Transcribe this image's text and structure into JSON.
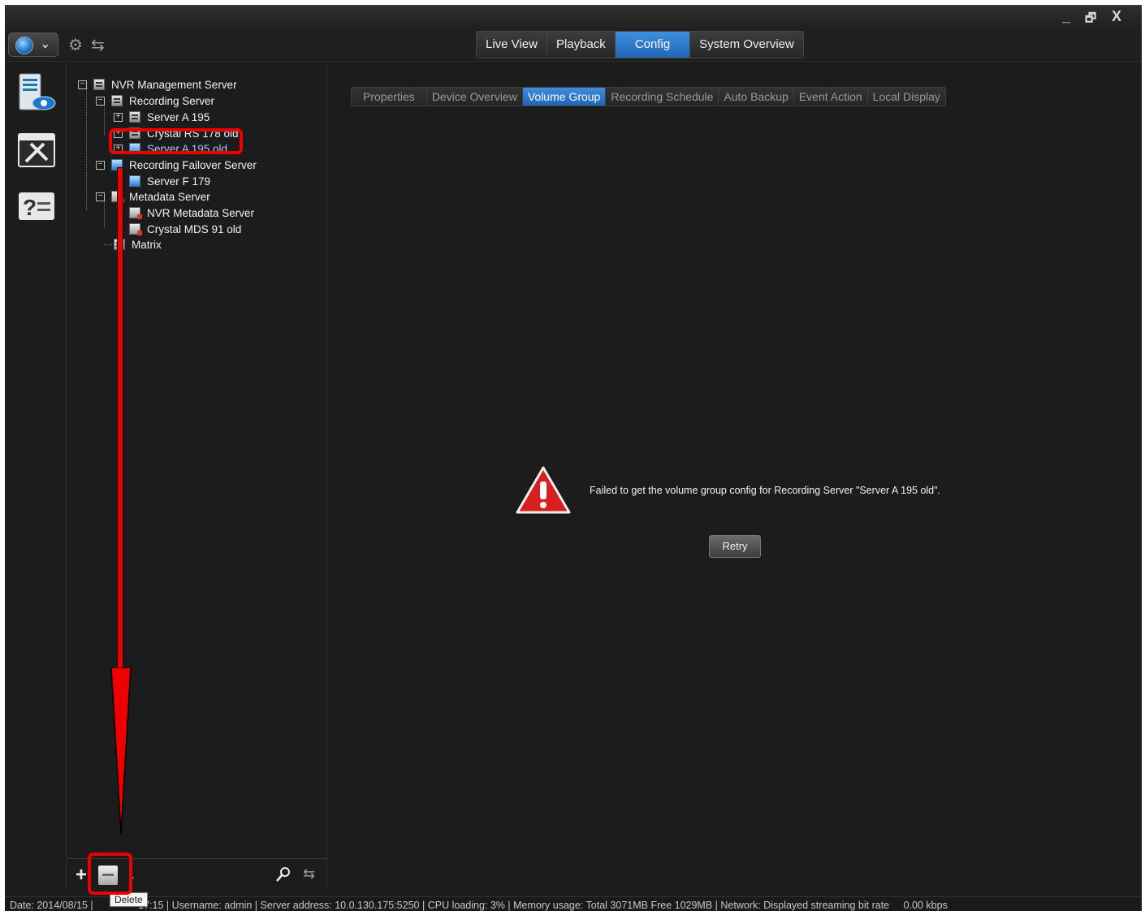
{
  "window_controls": {
    "minimize": "_",
    "restore": "🗗",
    "close": "X"
  },
  "main_tabs": [
    {
      "label": "Live View",
      "active": false
    },
    {
      "label": "Playback",
      "active": false
    },
    {
      "label": "Config",
      "active": true
    },
    {
      "label": "System Overview",
      "active": false
    }
  ],
  "tree": {
    "root": "NVR Management Server",
    "recording_server": "Recording Server",
    "rs_items": [
      "Server A 195",
      "Crystal RS 178 old",
      "Server A 195 old"
    ],
    "failover": "Recording Failover Server",
    "failover_items": [
      "Server F 179"
    ],
    "metadata": "Metadata Server",
    "metadata_items": [
      "NVR Metadata Server",
      "Crystal MDS 91 old"
    ],
    "matrix": "Matrix"
  },
  "sub_tabs": [
    {
      "label": "Properties",
      "active": false
    },
    {
      "label": "Device Overview",
      "active": false
    },
    {
      "label": "Volume Group",
      "active": true
    },
    {
      "label": "Recording Schedule",
      "active": false
    },
    {
      "label": "Auto Backup",
      "active": false
    },
    {
      "label": "Event Action",
      "active": false
    },
    {
      "label": "Local Display",
      "active": false
    }
  ],
  "error": {
    "message": "Failed to get the volume group config for Recording Server \"Server A 195 old\".",
    "retry_label": "Retry"
  },
  "tree_toolbar": {
    "add": "+",
    "sort": "↓",
    "search": "⚲"
  },
  "tooltip": "Delete",
  "statusbar": {
    "date": "Date: 2014/08/15",
    "time_partial": "17:15",
    "username": "Username: admin",
    "server_address": "Server address: 10.0.130.175:5250",
    "cpu": "CPU loading: 3%",
    "memory": "Memory usage: Total 3071MB  Free 1029MB",
    "network": "Network: Displayed streaming bit rate",
    "bitrate": "0.00 kbps"
  }
}
